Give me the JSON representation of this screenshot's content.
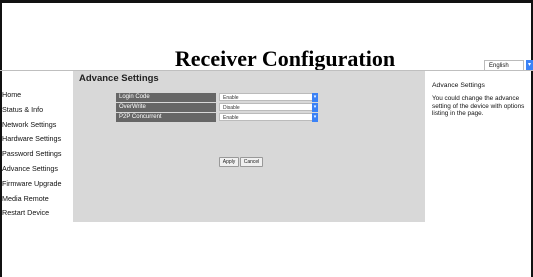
{
  "header": {
    "title": "Receiver Configuration",
    "language": "English"
  },
  "sidebar": {
    "items": [
      {
        "label": "Home"
      },
      {
        "label": "Status & Info"
      },
      {
        "label": "Network Settings"
      },
      {
        "label": "Hardware Settings"
      },
      {
        "label": "Password Settings"
      },
      {
        "label": "Advance Settings"
      },
      {
        "label": "Firmware Upgrade"
      },
      {
        "label": "Media Remote"
      },
      {
        "label": "Restart Device"
      }
    ]
  },
  "main": {
    "section_title": "Advance Settings",
    "fields": [
      {
        "label": "Login Code",
        "value": "Enable"
      },
      {
        "label": "OverWrite",
        "value": "Disable"
      },
      {
        "label": "P2P Concurrent",
        "value": "Enable"
      }
    ],
    "apply_label": "Apply",
    "cancel_label": "Cancel"
  },
  "help": {
    "title": "Advance Settings",
    "text": "You could change the advance setting of the device with options listing in the page."
  },
  "colors": {
    "content_bg": "#d8d8d8",
    "label_bg": "#666666",
    "select_arrow": "#3b82f6"
  }
}
